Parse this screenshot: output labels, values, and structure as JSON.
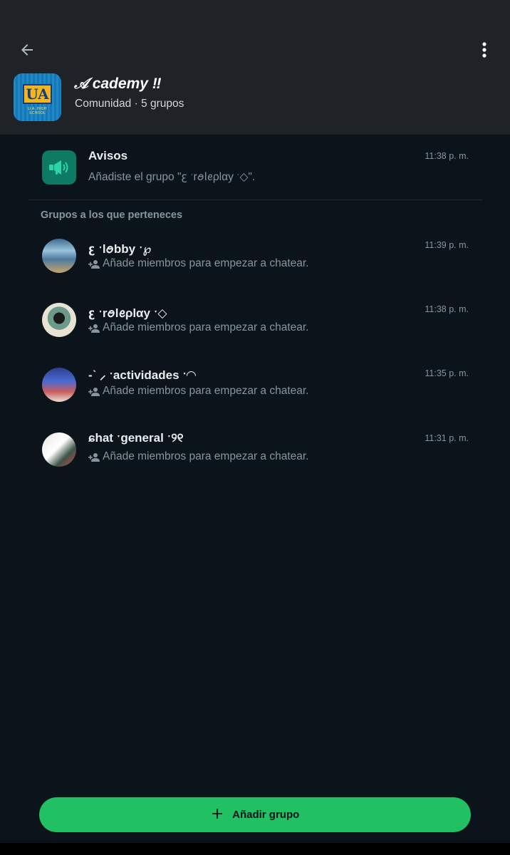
{
  "header": {
    "community_name": "𝒜 cademy ‼",
    "community_subtitle": "Comunidad · 5 grupos",
    "logo_text": "UA",
    "logo_sub": "U.A. HIGH SCHOOL",
    "icons": {
      "back": "arrow-back-icon",
      "menu": "more-vert-icon"
    }
  },
  "announcements": {
    "title": "Avisos",
    "subtitle": "Añadiste el grupo \"ꜫ ˑrꪮlꫀρlαy ˑ◇\".",
    "time": "11:38 p. m.",
    "icon": "megaphone-icon"
  },
  "groups_section": {
    "heading": "Grupos a los que perteneces",
    "items": [
      {
        "name": "ꜫ ˑlꪮbby ˑ℘",
        "subtitle": "Añade miembros para empezar a chatear.",
        "time": "11:39 p. m."
      },
      {
        "name": "ꜫ ˑrꪮlꫀρlαy ˑ◇",
        "subtitle": "Añade miembros para empezar a chatear.",
        "time": "11:38 p. m."
      },
      {
        "name": "-ˋ ⸝ ˑactividades ˑ◠",
        "subtitle": "Añade miembros para empezar a chatear.",
        "time": "11:35 p. m."
      },
      {
        "name": "ɕhat ˑgeneral ˑ୨୧",
        "subtitle": "Añade miembros para empezar a chatear.",
        "time": "11:31 p. m."
      }
    ]
  },
  "footer": {
    "add_group_label": "Añadir grupo",
    "icon": "plus-icon"
  },
  "colors": {
    "background": "#0b141a",
    "header": "#1f2328",
    "accent_green": "#21c063",
    "announcement_icon_bg": "#0f7a63",
    "secondary_text": "#8696a0"
  }
}
